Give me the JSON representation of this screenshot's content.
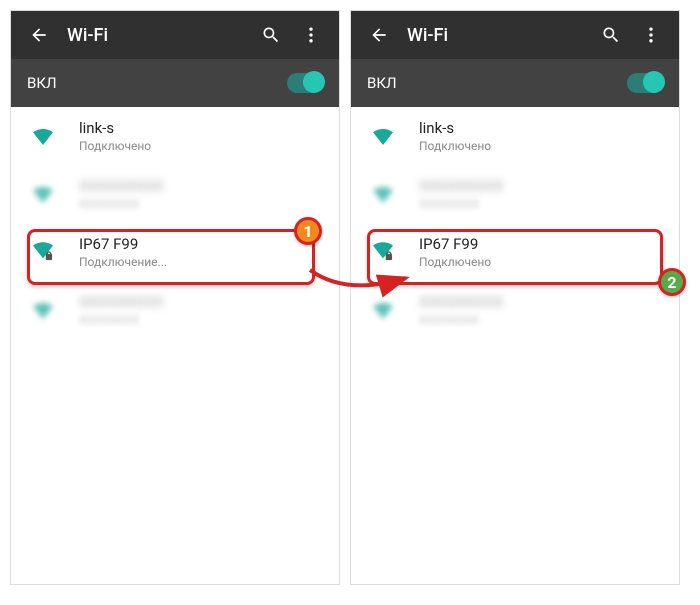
{
  "left": {
    "title": "Wi-Fi",
    "toggle_label": "ВКЛ",
    "networks": [
      {
        "name": "link-s",
        "sub": "Подключено"
      },
      {
        "name": "XXXXXXXXX",
        "sub": "XXXXXXXX"
      },
      {
        "name": "IP67 F99",
        "sub": "Подключение..."
      },
      {
        "name": "XXXXXXXXX",
        "sub": "XXXXXXXX"
      }
    ]
  },
  "right": {
    "title": "Wi-Fi",
    "toggle_label": "ВКЛ",
    "networks": [
      {
        "name": "link-s",
        "sub": "Подключено"
      },
      {
        "name": "XXXXXXXXX",
        "sub": "XXXXXXXX"
      },
      {
        "name": "IP67 F99",
        "sub": "Подключено"
      },
      {
        "name": "XXXXXXXXX",
        "sub": "XXXXXXXX"
      }
    ]
  },
  "callouts": {
    "one": "1",
    "two": "2"
  }
}
